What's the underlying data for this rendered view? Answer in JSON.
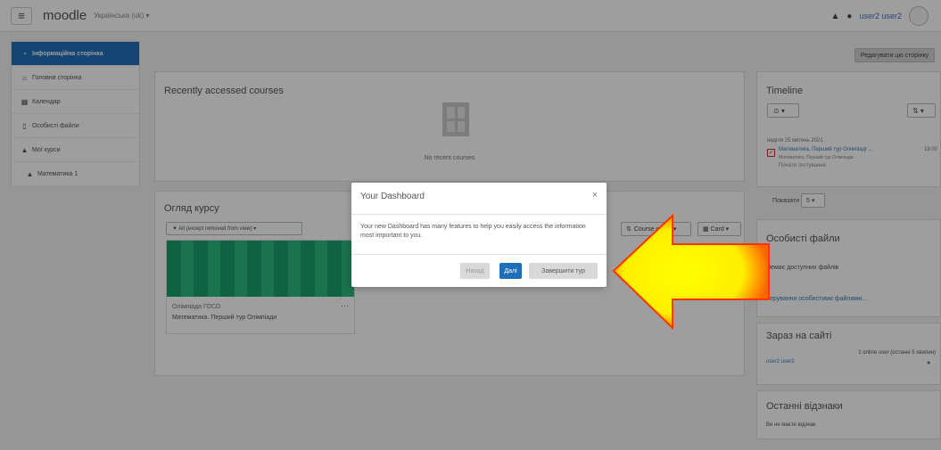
{
  "navbar": {
    "brand": "moodle",
    "language": "Українська (uk) ▾",
    "user_name": "user2 user2"
  },
  "drawer": {
    "items": [
      {
        "label": "Інформаційна сторінка",
        "icon": "tachometer-icon"
      },
      {
        "label": "Головна сторінка",
        "icon": "home-icon"
      },
      {
        "label": "Календар",
        "icon": "calendar-icon"
      },
      {
        "label": "Особисті файли",
        "icon": "file-icon"
      },
      {
        "label": "Мої курси",
        "icon": "graduation-cap-icon"
      },
      {
        "label": "Математика 1",
        "icon": "graduation-cap-icon"
      }
    ]
  },
  "edit_button": "Редагувати цю сторінку",
  "recent": {
    "title": "Recently accessed courses",
    "empty": "No recent courses"
  },
  "overview": {
    "title": "Огляд курсу",
    "filter": "▼ All (except removed from view) ▾",
    "sort": "Course name ▾",
    "view": "Card ▾",
    "course": {
      "category": "Олімпіада ГОСО",
      "name": "Математика. Перший тур Олімпіади"
    }
  },
  "timeline": {
    "title": "Timeline",
    "filter_btn": "⊙ ▾",
    "sort_btn": "⇅ ▾",
    "date": "неділя 25 квітень 2021",
    "event": "Математика. Перший тур Олімпіаді ...",
    "time": "18:00",
    "event_sub": "Математика. Перший тур Олімпіади",
    "action": "Почати тестування",
    "show_label": "Показати",
    "show_value": "5 ▾"
  },
  "files": {
    "title": "Особисті файли",
    "empty": "Немає доступних файлів",
    "link": "Керування особистими файлами..."
  },
  "online": {
    "title": "Зараз на сайті",
    "count": "1 online user (останні 5 хвилин)",
    "user": "user2 user2"
  },
  "badges": {
    "title": "Останні відзнаки",
    "empty": "Ви не маєте відзнак"
  },
  "modal": {
    "title": "Your Dashboard",
    "close": "×",
    "body": "Your new Dashboard has many features to help you easily access the information most important to you.",
    "prev": "Назад",
    "next": "Далі",
    "end": "Завершити тур"
  },
  "colors": {
    "primary": "#1f6fb8",
    "arrow_fill": "#ffff00",
    "arrow_edge": "#ff3300"
  }
}
